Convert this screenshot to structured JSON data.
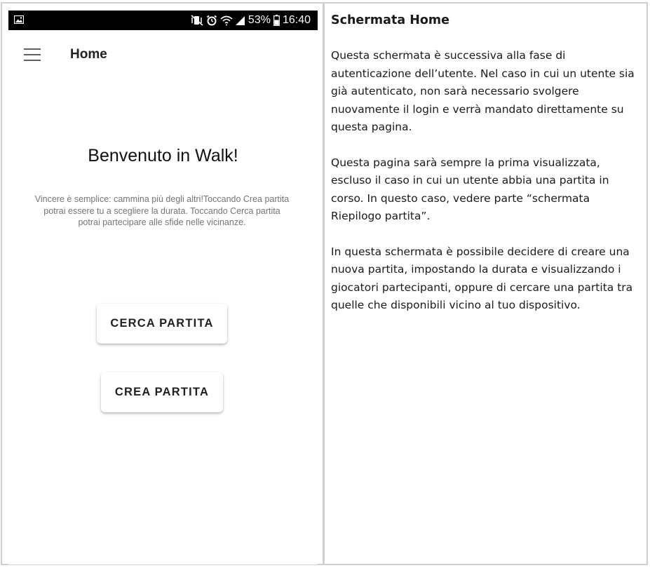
{
  "status_bar": {
    "icons": [
      "gallery-icon",
      "vibrate-mute-icon",
      "alarm-icon",
      "wifi-icon",
      "signal-icon",
      "battery-icon"
    ],
    "battery_percent": "53%",
    "time": "16:40"
  },
  "app_bar": {
    "menu_icon": "hamburger-menu-icon",
    "title": "Home"
  },
  "home": {
    "welcome_title": "Benvenuto in Walk!",
    "welcome_text": "Vincere è semplice: cammina più degli altri!Toccando Crea partita potrai essere tu a scegliere la durata. Toccando Cerca partita potrai partecipare alle sfide nelle vicinanze.",
    "search_button": "CERCA PARTITA",
    "create_button": "CREA PARTITA"
  },
  "description": {
    "title": "Schermata Home",
    "paragraphs": [
      "Questa schermata è successiva alla fase di autenticazione dell’utente. Nel caso in cui un utente sia già autenticato, non sarà necessario svolgere nuovamente il login e verrà mandato direttamente su questa pagina.",
      "Questa pagina sarà sempre la prima visualizzata, escluso il caso in cui un utente abbia una partita in corso.  In questo caso, vedere parte “schermata Riepilogo partita”.",
      "In questa schermata è possibile decidere di creare una nuova partita, impostando la durata e visualizzando i giocatori partecipanti, oppure di cercare una partita tra quelle che disponibili vicino al tuo dispositivo."
    ]
  },
  "colors": {
    "status_bar_bg": "#000000",
    "text_primary": "#212121",
    "text_secondary": "#757575",
    "border": "#d0d0d0"
  }
}
